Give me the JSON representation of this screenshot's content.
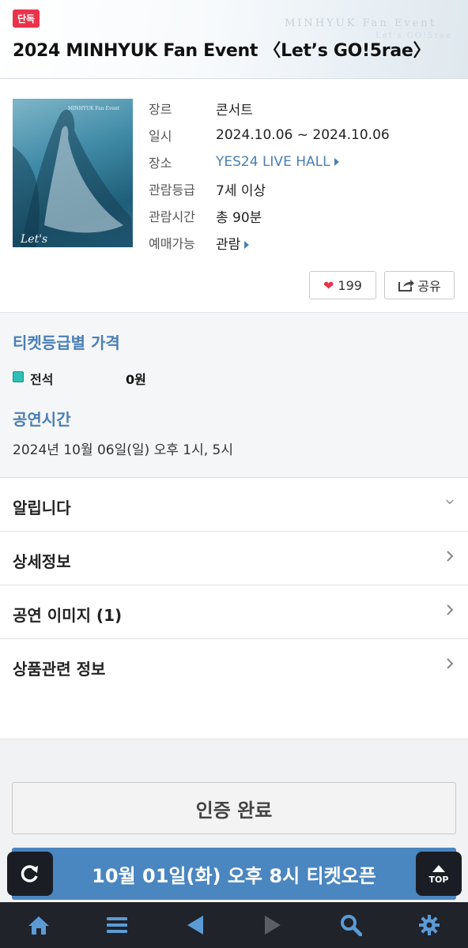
{
  "header": {
    "badge": "단독",
    "title": "2024 MINHYUK Fan Event 〈Let’s GO!5rae〉",
    "watermark_line1": "MINHYUK Fan Event",
    "watermark_line2": "Let's GO!5rae"
  },
  "info": {
    "rows": [
      {
        "key": "장르",
        "value": "콘서트"
      },
      {
        "key": "일시",
        "value": "2024.10.06 ~ 2024.10.06"
      },
      {
        "key": "장소",
        "value": "YES24 LIVE HALL"
      },
      {
        "key": "관람등급",
        "value": "7세 이상"
      },
      {
        "key": "관람시간",
        "value": "총 90분"
      },
      {
        "key": "예매가능",
        "value": "관람"
      }
    ]
  },
  "poster": {
    "caption": "Let's",
    "header_text": "MINHYUK Fan Event"
  },
  "actions": {
    "like_count": "199",
    "share_label": "공유"
  },
  "price": {
    "title": "티켓등급별 가격",
    "seat_name": "전석",
    "seat_price": "0원"
  },
  "showtime": {
    "title": "공연시간",
    "text": "2024년 10월 06일(일) 오후 1시, 5시"
  },
  "accordion": [
    {
      "label": "알립니다"
    },
    {
      "label": "상세정보"
    },
    {
      "label": "공연 이미지 (1)"
    },
    {
      "label": "상품관련 정보"
    }
  ],
  "buttons": {
    "auth": "인증 완료",
    "open": "10월 01일(화) 오후 8시 티켓오픈",
    "top_label": "TOP"
  },
  "colors": {
    "accent": "#4a7fb5",
    "badge": "#e8334a",
    "open_button": "#4a86c0",
    "nav_bg": "#20232a"
  },
  "nav_icons": [
    "home-icon",
    "menu-icon",
    "back-icon",
    "forward-icon",
    "search-icon",
    "settings-icon"
  ]
}
